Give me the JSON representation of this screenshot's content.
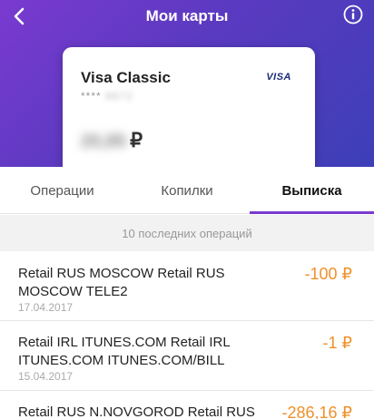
{
  "header": {
    "title": "Мои карты",
    "back_icon": "chevron-left-icon",
    "info_icon": "info-icon"
  },
  "card": {
    "name": "Visa Classic",
    "brand": "VISA",
    "number_mask": "**** ",
    "number_hidden": "8672",
    "balance_hidden": "20,85",
    "currency": "₽"
  },
  "tabs": [
    {
      "label": "Операции",
      "active": false
    },
    {
      "label": "Копилки",
      "active": false
    },
    {
      "label": "Выписка",
      "active": true
    }
  ],
  "section_label": "10 последних операций",
  "operations": [
    {
      "description": "Retail RUS MOSCOW Retail RUS MOSCOW TELE2",
      "date": "17.04.2017",
      "amount": "-100 ₽"
    },
    {
      "description": "Retail IRL ITUNES.COM Retail IRL ITUNES.COM ITUNES.COM/BILL",
      "date": "15.04.2017",
      "amount": "-1 ₽"
    },
    {
      "description": "Retail RUS N.NOVGOROD Retail RUS",
      "date": "",
      "amount": "-286,16 ₽"
    }
  ],
  "colors": {
    "accent": "#7a3ad0",
    "amount": "#f0902a"
  }
}
